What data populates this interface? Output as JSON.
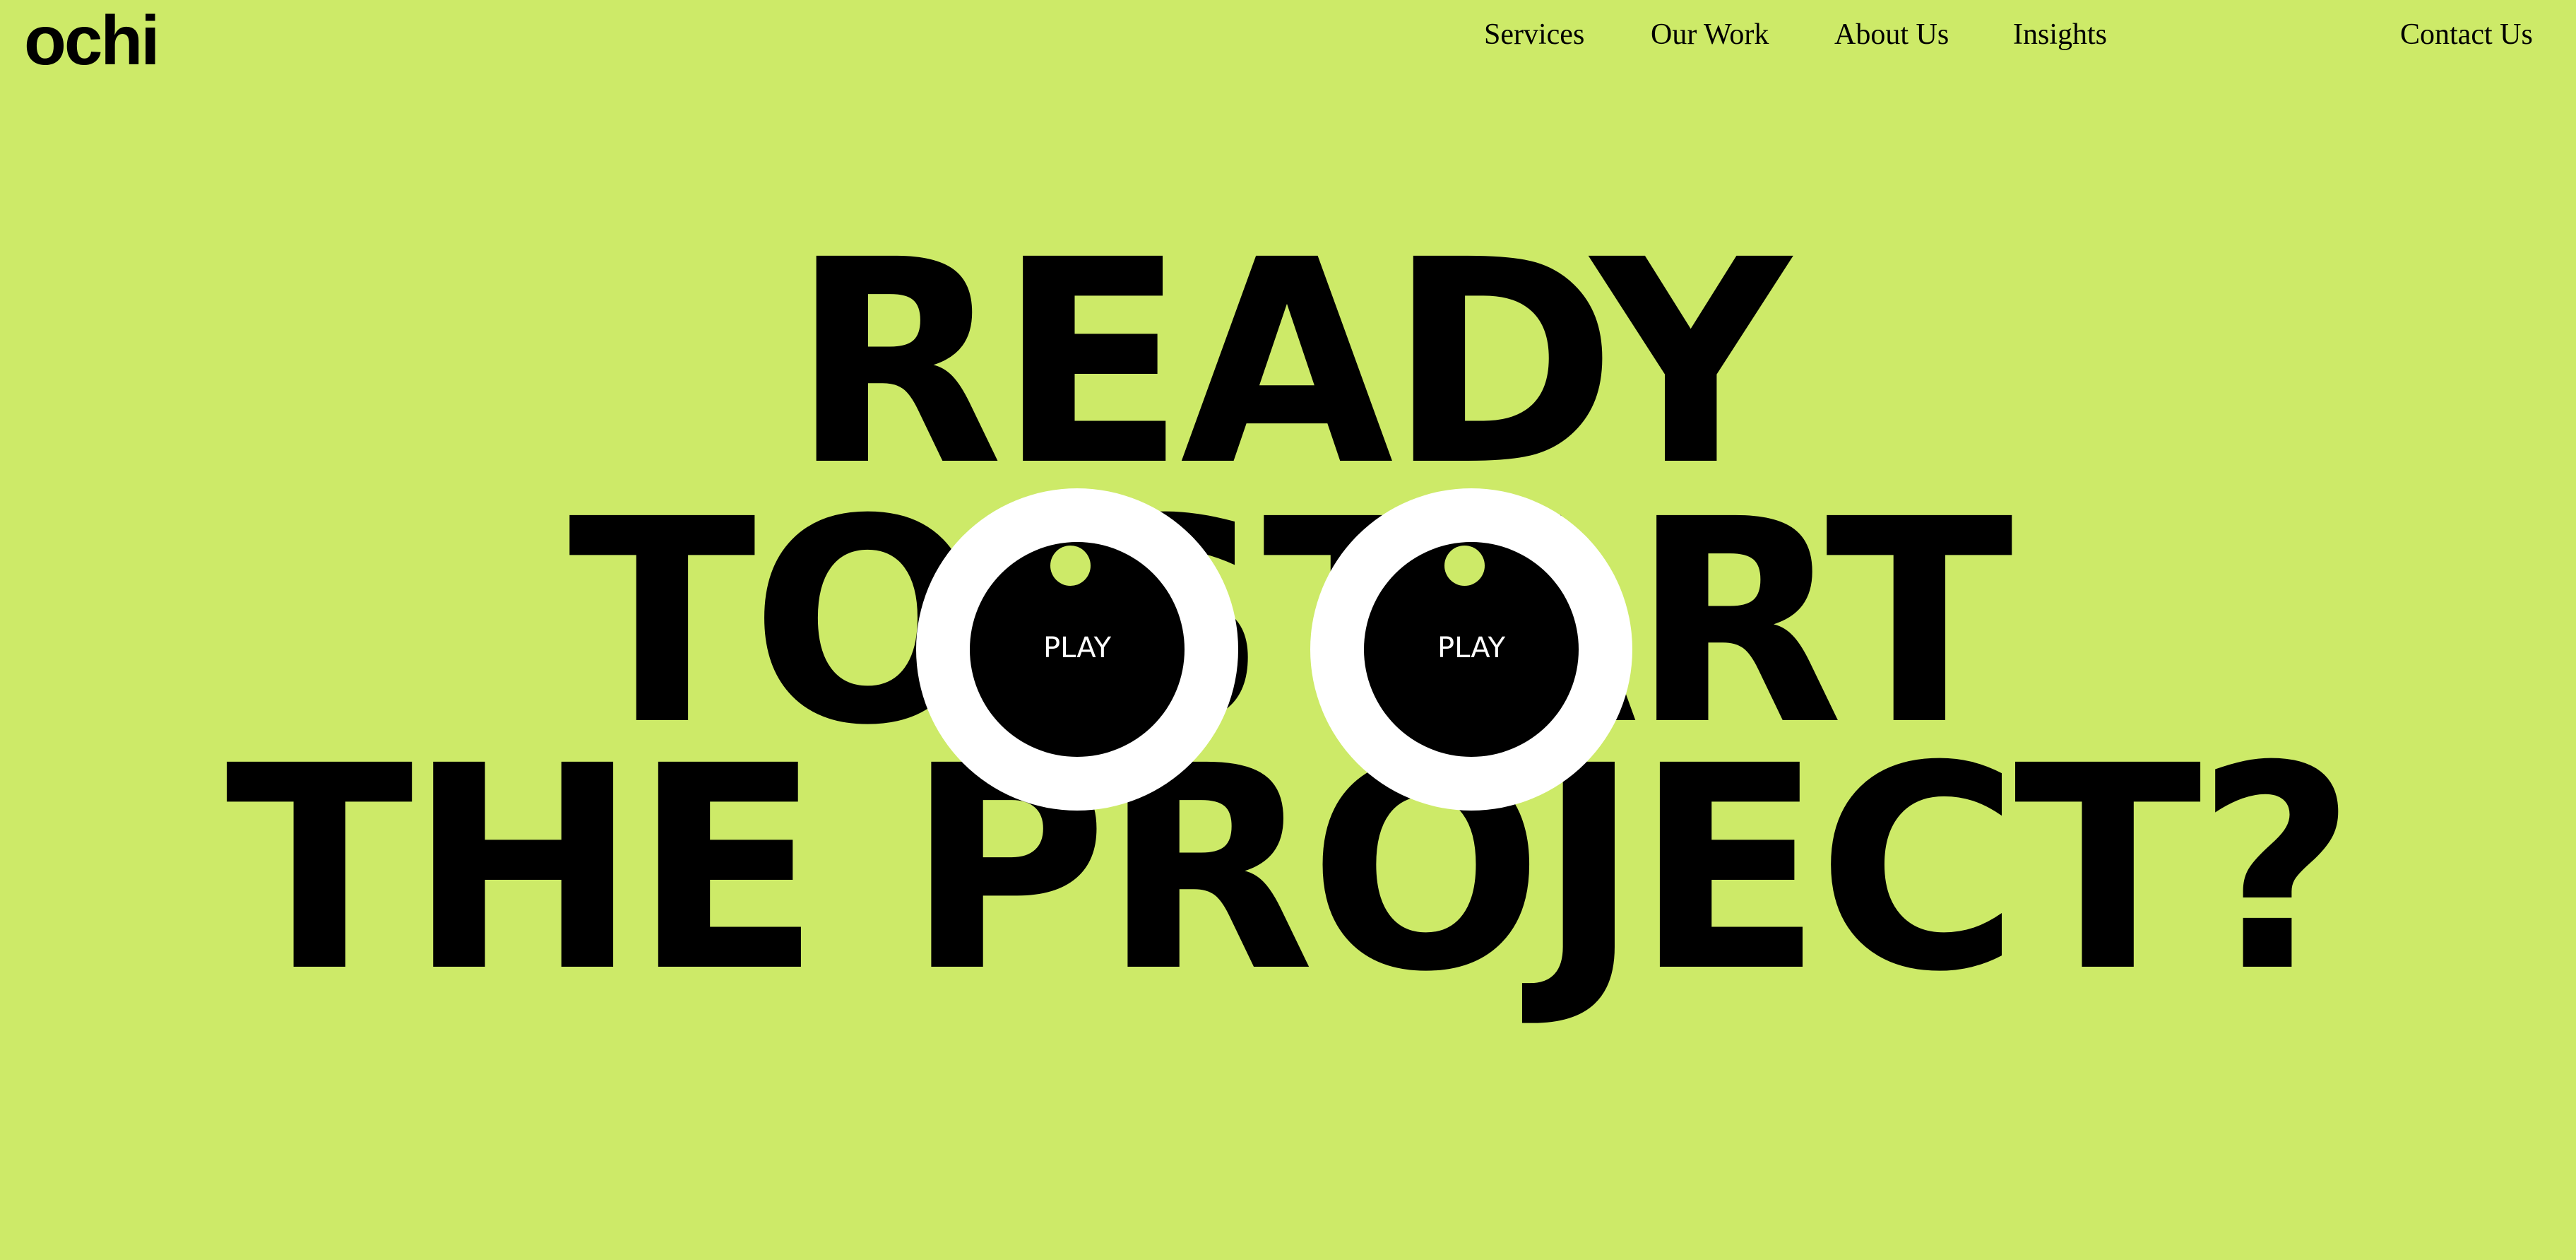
{
  "brand": {
    "logo_text": "ochi",
    "background_color": "#cdea68"
  },
  "nav": {
    "links": [
      "Services",
      "Our Work",
      "About Us",
      "Insights"
    ],
    "contact": "Contact Us"
  },
  "hero": {
    "lines": [
      "READY",
      "TO START",
      "THE PROJECT?"
    ]
  },
  "eyes": [
    {
      "label": "PLAY"
    },
    {
      "label": "PLAY"
    }
  ]
}
